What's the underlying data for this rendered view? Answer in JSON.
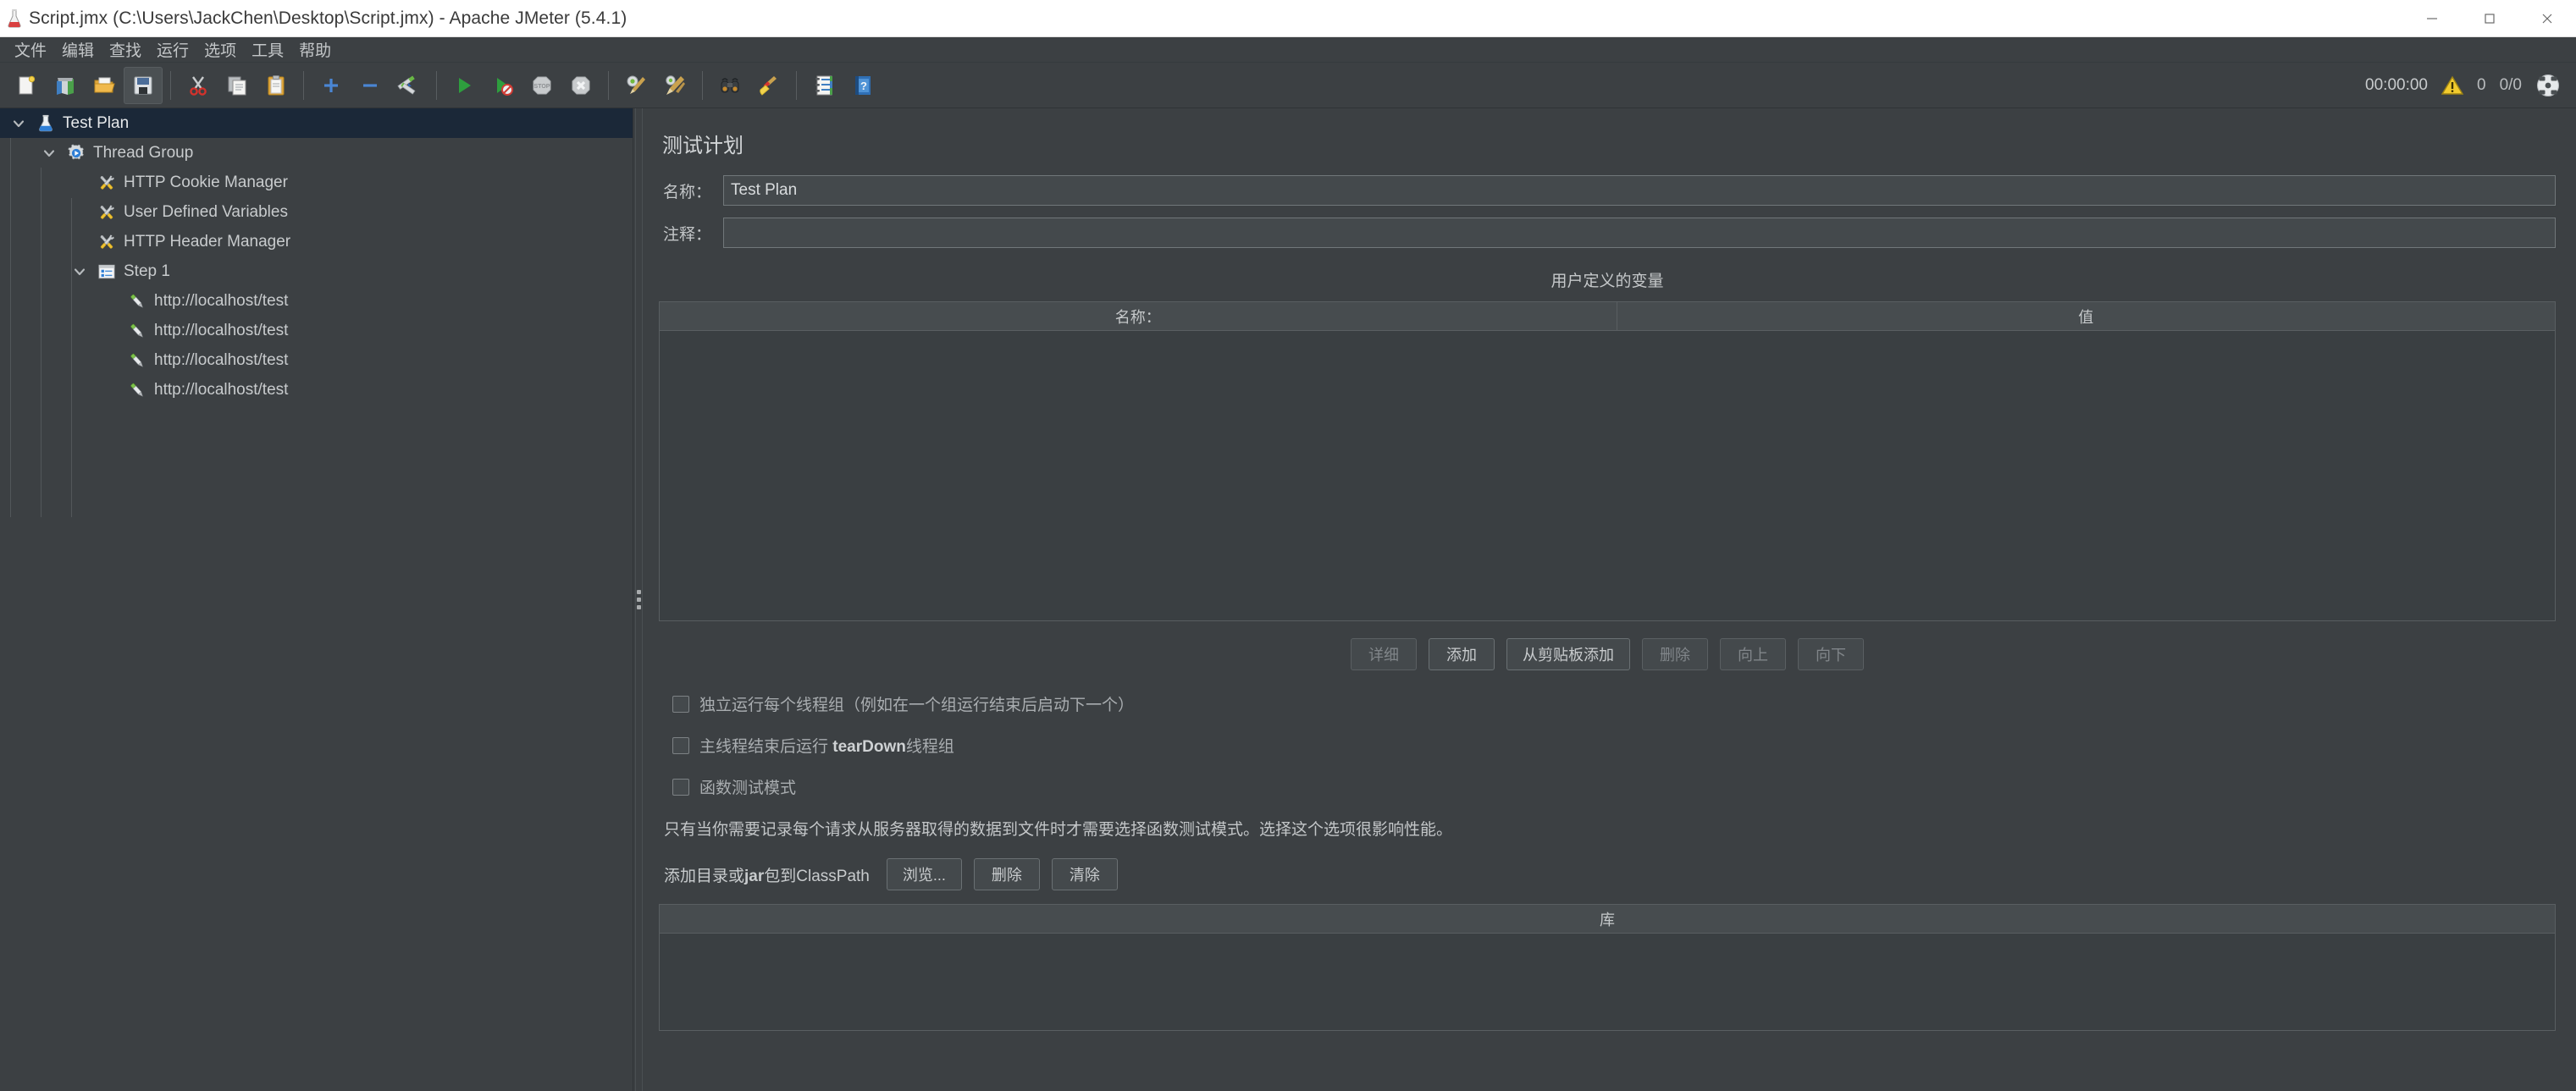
{
  "window": {
    "title": "Script.jmx (C:\\Users\\JackChen\\Desktop\\Script.jmx) - Apache JMeter (5.4.1)",
    "app_icon": "jmeter-flask-icon",
    "minimize": "—",
    "maximize": "□",
    "close": "✕"
  },
  "menubar": {
    "items": [
      {
        "label": "文件",
        "name": "menu-file"
      },
      {
        "label": "编辑",
        "name": "menu-edit"
      },
      {
        "label": "查找",
        "name": "menu-search"
      },
      {
        "label": "运行",
        "name": "menu-run"
      },
      {
        "label": "选项",
        "name": "menu-options"
      },
      {
        "label": "工具",
        "name": "menu-tools"
      },
      {
        "label": "帮助",
        "name": "menu-help"
      }
    ]
  },
  "toolbar": {
    "buttons": [
      {
        "icon": "new-file-icon"
      },
      {
        "icon": "templates-icon"
      },
      {
        "icon": "open-folder-icon"
      },
      {
        "icon": "save-icon",
        "pressed": true
      },
      {
        "sep": true
      },
      {
        "icon": "cut-scissors-icon"
      },
      {
        "icon": "copy-icon"
      },
      {
        "icon": "paste-clipboard-icon"
      },
      {
        "sep": true
      },
      {
        "icon": "expand-plus-icon"
      },
      {
        "icon": "collapse-minus-icon"
      },
      {
        "icon": "toggle-enable-icon"
      },
      {
        "sep": true
      },
      {
        "icon": "start-play-icon"
      },
      {
        "icon": "start-no-pauses-icon"
      },
      {
        "icon": "stop-icon"
      },
      {
        "icon": "shutdown-icon"
      },
      {
        "sep": true
      },
      {
        "icon": "clear-icon"
      },
      {
        "icon": "clear-all-icon"
      },
      {
        "sep": true
      },
      {
        "icon": "search-binoculars-icon"
      },
      {
        "icon": "reset-search-broom-icon"
      },
      {
        "sep": true
      },
      {
        "icon": "function-helper-icon"
      },
      {
        "icon": "help-book-icon"
      }
    ],
    "timer": "00:00:00",
    "warning_icon": "warning-triangle-icon",
    "warning_count": "0",
    "threads": "0/0",
    "remote_icon": "remote-engines-icon"
  },
  "tree": {
    "nodes": [
      {
        "label": "Test Plan",
        "icon": "test-plan-flask-icon",
        "depth": 0,
        "toggle": "expanded",
        "selected": true,
        "name": "tree-node-test-plan"
      },
      {
        "label": "Thread Group",
        "icon": "thread-group-gear-icon",
        "depth": 1,
        "toggle": "expanded",
        "selected": false,
        "name": "tree-node-thread-group"
      },
      {
        "label": "HTTP Cookie Manager",
        "icon": "config-element-tools-icon",
        "depth": 2,
        "toggle": "none",
        "selected": false,
        "name": "tree-node-http-cookie-manager"
      },
      {
        "label": "User Defined Variables",
        "icon": "config-element-tools-icon",
        "depth": 2,
        "toggle": "none",
        "selected": false,
        "name": "tree-node-user-defined-variables"
      },
      {
        "label": "HTTP Header Manager",
        "icon": "config-element-tools-icon",
        "depth": 2,
        "toggle": "none",
        "selected": false,
        "name": "tree-node-http-header-manager"
      },
      {
        "label": "Step 1",
        "icon": "transaction-controller-icon",
        "depth": 2,
        "toggle": "expanded",
        "selected": false,
        "name": "tree-node-step-1"
      },
      {
        "label": "http://localhost/test",
        "icon": "http-sampler-pen-icon",
        "depth": 3,
        "toggle": "none",
        "selected": false,
        "name": "tree-node-http-sampler-1"
      },
      {
        "label": "http://localhost/test",
        "icon": "http-sampler-pen-icon",
        "depth": 3,
        "toggle": "none",
        "selected": false,
        "name": "tree-node-http-sampler-2"
      },
      {
        "label": "http://localhost/test",
        "icon": "http-sampler-pen-icon",
        "depth": 3,
        "toggle": "none",
        "selected": false,
        "name": "tree-node-http-sampler-3"
      },
      {
        "label": "http://localhost/test",
        "icon": "http-sampler-pen-icon",
        "depth": 3,
        "toggle": "none",
        "selected": false,
        "name": "tree-node-http-sampler-4"
      }
    ]
  },
  "main": {
    "panel_title": "测试计划",
    "name_label": "名称：",
    "name_value": "Test Plan",
    "comment_label": "注释：",
    "comment_value": "",
    "variables_title": "用户定义的变量",
    "table": {
      "columns": [
        "名称：",
        "值"
      ],
      "rows": []
    },
    "buttons": [
      {
        "label": "详细",
        "disabled": true,
        "name": "detail-button"
      },
      {
        "label": "添加",
        "disabled": false,
        "name": "add-button"
      },
      {
        "label": "从剪贴板添加",
        "disabled": false,
        "name": "add-from-clipboard-button"
      },
      {
        "label": "删除",
        "disabled": true,
        "name": "delete-button"
      },
      {
        "label": "向上",
        "disabled": true,
        "name": "move-up-button"
      },
      {
        "label": "向下",
        "disabled": true,
        "name": "move-down-button"
      }
    ],
    "checkboxes": [
      {
        "label": "独立运行每个线程组（例如在一个组运行结束后启动下一个）",
        "checked": false,
        "name": "serialize-thread-groups-checkbox"
      },
      {
        "label_pre": "主线程结束后运行 ",
        "label_bold": "tearDown",
        "label_post": "线程组",
        "checked": false,
        "name": "run-teardown-checkbox"
      },
      {
        "label": "函数测试模式",
        "checked": false,
        "name": "functional-test-mode-checkbox"
      }
    ],
    "note": "只有当你需要记录每个请求从服务器取得的数据到文件时才需要选择函数测试模式。选择这个选项很影响性能。",
    "classpath_label_pre": "添加目录或",
    "classpath_label_bold": "jar",
    "classpath_label_post": "包到ClassPath",
    "classpath_buttons": [
      {
        "label": "浏览...",
        "name": "browse-button"
      },
      {
        "label": "删除",
        "name": "classpath-delete-button"
      },
      {
        "label": "清除",
        "name": "classpath-clear-button"
      }
    ],
    "library_header": "库"
  },
  "colors": {
    "window_bg": "#3c4043",
    "titlebar_bg": "#ffffff",
    "selection_bg": "#1b2838",
    "text": "#c8cbcd",
    "field_bg": "#44494c",
    "border": "#6a7073"
  }
}
